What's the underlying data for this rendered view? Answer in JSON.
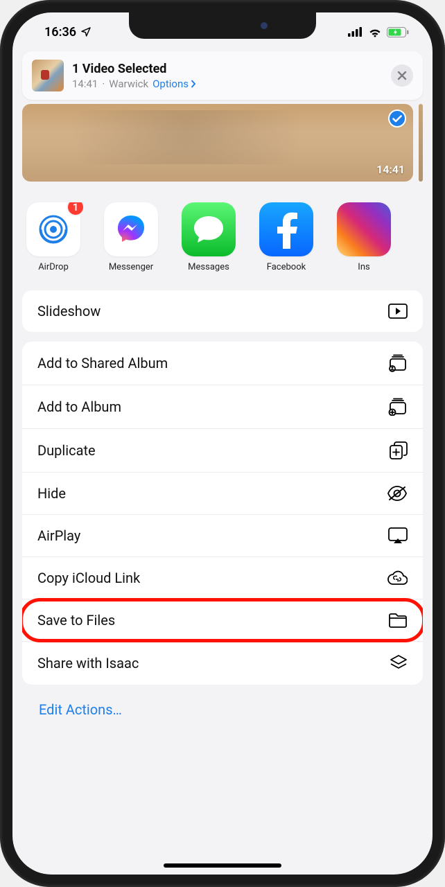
{
  "status": {
    "time": "16:36"
  },
  "header": {
    "title": "1 Video Selected",
    "sub_time": "14:41",
    "sub_location": "Warwick",
    "options_label": "Options"
  },
  "preview": {
    "duration": "14:41"
  },
  "apps": [
    {
      "label": "AirDrop",
      "badge": "1"
    },
    {
      "label": "Messenger"
    },
    {
      "label": "Messages"
    },
    {
      "label": "Facebook"
    },
    {
      "label": "Ins"
    }
  ],
  "group1": [
    {
      "label": "Slideshow"
    }
  ],
  "group2": [
    {
      "label": "Add to Shared Album"
    },
    {
      "label": "Add to Album"
    },
    {
      "label": "Duplicate"
    },
    {
      "label": "Hide"
    },
    {
      "label": "AirPlay"
    },
    {
      "label": "Copy iCloud Link"
    },
    {
      "label": "Save to Files"
    },
    {
      "label": "Share with Isaac"
    }
  ],
  "edit_actions": "Edit Actions…",
  "colors": {
    "accent": "#1f7fe8",
    "highlight": "#ff1203"
  }
}
